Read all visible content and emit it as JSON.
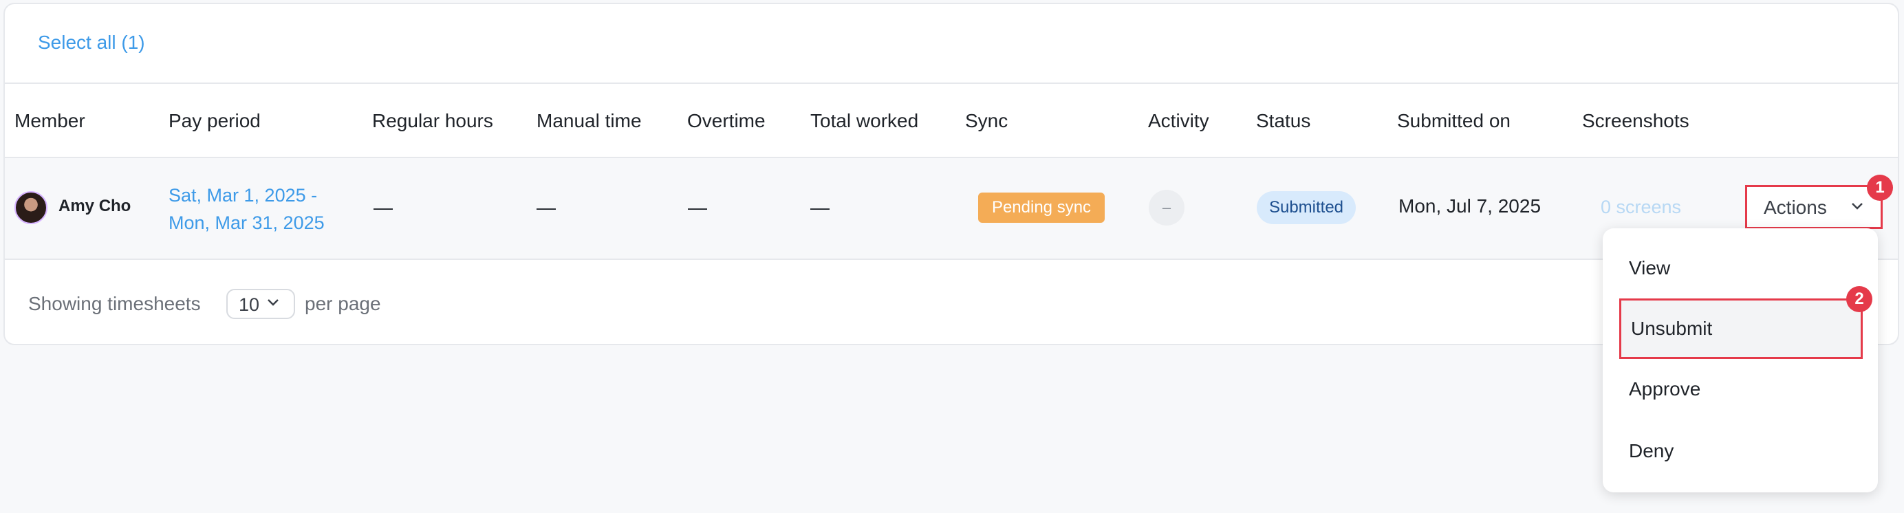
{
  "toolbar": {
    "select_all": "Select all (1)"
  },
  "table": {
    "headers": [
      "Member",
      "Pay period",
      "Regular hours",
      "Manual time",
      "Overtime",
      "Total worked",
      "Sync",
      "Activity",
      "Status",
      "Submitted on",
      "Screenshots"
    ],
    "row": {
      "member": "Amy Cho",
      "pay_period_line1": "Sat, Mar 1, 2025 -",
      "pay_period_line2": "Mon, Mar 31, 2025",
      "regular_hours": "—",
      "manual_time": "—",
      "overtime": "—",
      "total_worked": "—",
      "sync": "Pending sync",
      "activity": "–",
      "status": "Submitted",
      "submitted_on": "Mon, Jul 7, 2025",
      "screenshots": "0 screens",
      "actions_label": "Actions"
    }
  },
  "footer": {
    "showing_label": "Showing timesheets",
    "per_page_value": "10",
    "per_page_label": "per page"
  },
  "actions_menu": {
    "items": [
      "View",
      "Unsubmit",
      "Approve",
      "Deny"
    ]
  },
  "annotations": {
    "step1": "1",
    "step2": "2"
  },
  "colors": {
    "link": "#3d9ae8",
    "sync_badge": "#f4ac56",
    "status_badge_bg": "#d8eafc",
    "highlight_border": "#e53a4a"
  },
  "icons": {
    "dropdown_chevron": "chevron-down-icon"
  }
}
